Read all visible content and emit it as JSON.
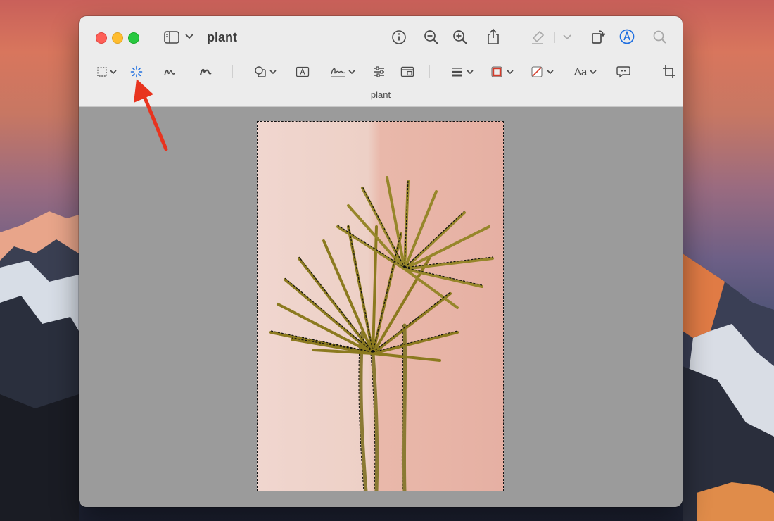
{
  "window": {
    "title": "plant",
    "document_label": "plant"
  },
  "toolbar_top": {
    "sidebar_toggle": "sidebar-icon",
    "info": "info-icon",
    "zoom_out": "zoom-out-icon",
    "zoom_in": "zoom-in-icon",
    "share": "share-icon",
    "highlight": "highlighter-icon",
    "rotate": "rotate-icon",
    "markup": "markup-icon",
    "search": "search-icon"
  },
  "markup_toolbar": {
    "text_style_label": "Aa",
    "tools": [
      "rectangular-selection",
      "instant-alpha",
      "sketch",
      "draw",
      "shapes",
      "text",
      "sign",
      "adjust-color",
      "adjust-size",
      "shape-style",
      "border-color",
      "fill-color",
      "text-style",
      "annotate",
      "crop"
    ]
  },
  "colors": {
    "accent_blue": "#1f6fe0",
    "border_color_red": "#d63b2a",
    "arrow_red": "#e8341f",
    "close": "#fe5f57",
    "minimize": "#febc2e",
    "maximize": "#28c840"
  }
}
